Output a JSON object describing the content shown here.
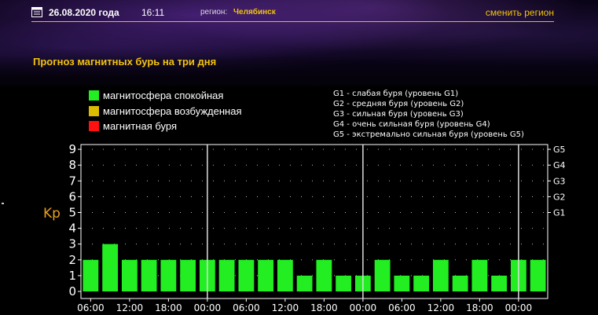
{
  "header": {
    "date": "26.08.2020 года",
    "time": "16:11",
    "region_label": "регион:",
    "region_value": "Челябинск",
    "change_region": "сменить регион"
  },
  "title": "Прогноз магнитных бурь на три дня",
  "legend": [
    {
      "label": "магнитосфера спокойная",
      "color": "#22ee22"
    },
    {
      "label": "магнитосфера возбужденная",
      "color": "#ddbb00"
    },
    {
      "label": "магнитная буря",
      "color": "#ff1111"
    }
  ],
  "g_legend": [
    "G1 - слабая буря (уровень G1)",
    "G2 - средняя буря (уровень G2)",
    "G3 - сильная буря (уровень G3)",
    "G4 - очень сильная буря (уровень G4)",
    "G5 - экстремально сильная буря (уровень G5)"
  ],
  "colors": {
    "accent": "#f2c40c",
    "bar": "#22ee22",
    "axis": "#ffffff"
  },
  "chart_data": {
    "type": "bar",
    "ylabel": "Kp",
    "ylim": [
      0,
      9
    ],
    "yticks": [
      "0",
      "1",
      "2",
      "3",
      "4",
      "5",
      "6",
      "7",
      "8",
      "9"
    ],
    "right_ticks": [
      {
        "label": "G1",
        "level": 5
      },
      {
        "label": "G2",
        "level": 6
      },
      {
        "label": "G3",
        "level": 7
      },
      {
        "label": "G4",
        "level": 8
      },
      {
        "label": "G5",
        "level": 9
      }
    ],
    "xticks": [
      "06:00",
      "12:00",
      "18:00",
      "00:00",
      "06:00",
      "12:00",
      "18:00",
      "00:00",
      "06:00",
      "12:00",
      "18:00",
      "00:00"
    ],
    "values": [
      2,
      3,
      2,
      2,
      2,
      2,
      2,
      2,
      2,
      2,
      2,
      1,
      2,
      1,
      1,
      2,
      1,
      1,
      2,
      1,
      2,
      1,
      2,
      2
    ],
    "day_separators_after_bar": [
      6,
      14,
      22
    ],
    "grid": "dotted"
  }
}
